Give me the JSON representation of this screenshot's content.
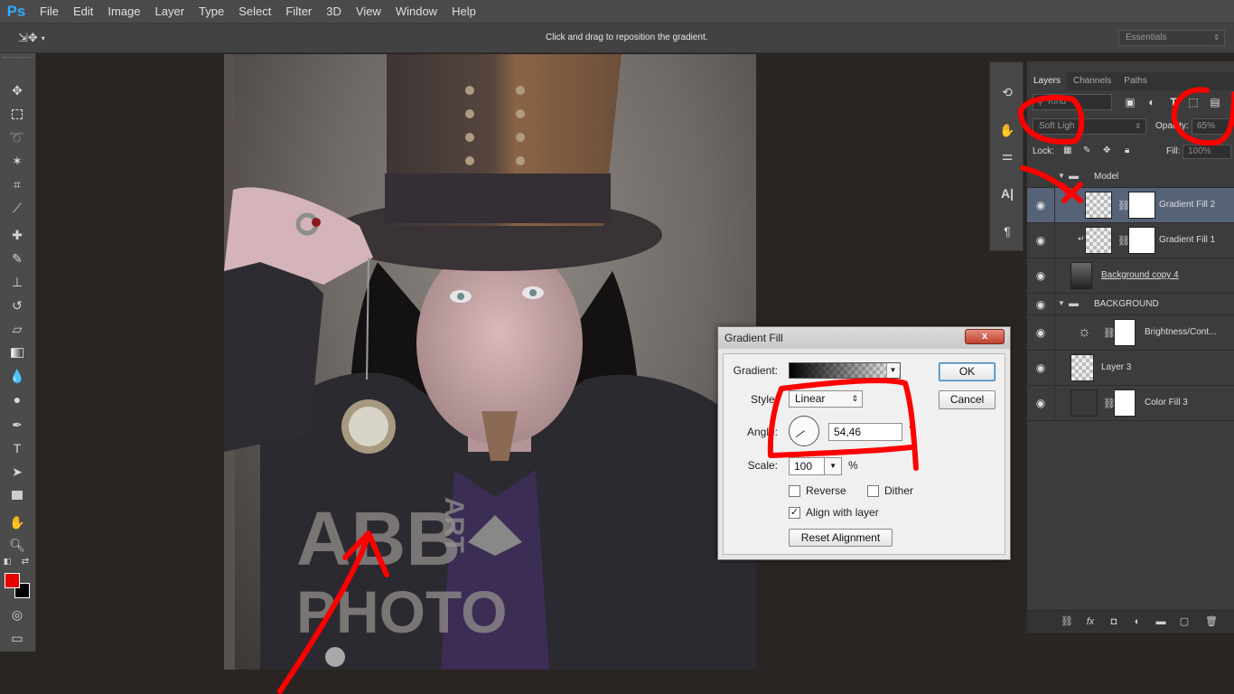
{
  "app": {
    "logo": "Ps"
  },
  "menu": [
    "File",
    "Edit",
    "Image",
    "Layer",
    "Type",
    "Select",
    "Filter",
    "3D",
    "View",
    "Window",
    "Help"
  ],
  "options_bar": {
    "hint": "Click and drag to reposition the gradient.",
    "workspace": "Essentials"
  },
  "watermark": {
    "line1": "ABB",
    "line2": "PHOTO",
    "vertical": "ART"
  },
  "colors": {
    "foreground": "#e60000",
    "background": "#000000",
    "annotation": "#ff0000"
  },
  "dialog": {
    "title": "Gradient Fill",
    "close": "x",
    "gradient_label": "Gradient:",
    "style_label": "Style:",
    "style_value": "Linear",
    "angle_label": "Angle:",
    "angle_value": "54,46",
    "angle_unit": "°",
    "scale_label": "Scale:",
    "scale_value": "100",
    "scale_unit": "%",
    "reverse_label": "Reverse",
    "dither_label": "Dither",
    "align_label": "Align with layer",
    "reset_label": "Reset Alignment",
    "ok_label": "OK",
    "cancel_label": "Cancel"
  },
  "layers_panel": {
    "tabs": [
      "Layers",
      "Channels",
      "Paths"
    ],
    "kind_placeholder": "Kind",
    "blend_mode": "Soft Ligh",
    "opacity_label": "Opacity:",
    "opacity_value": "65%",
    "lock_label": "Lock:",
    "fill_label": "Fill:",
    "fill_value": "100%",
    "layers": [
      {
        "name": "Model",
        "type": "group"
      },
      {
        "name": "Gradient Fill 2",
        "type": "gradient",
        "selected": true
      },
      {
        "name": "Gradient Fill 1",
        "type": "gradient"
      },
      {
        "name": "Background copy 4",
        "type": "photo"
      },
      {
        "name": "BACKGROUND",
        "type": "group"
      },
      {
        "name": "Brightness/Cont...",
        "type": "adjustment"
      },
      {
        "name": "Layer 3",
        "type": "pixel"
      },
      {
        "name": "Color Fill 3",
        "type": "fill"
      }
    ]
  }
}
